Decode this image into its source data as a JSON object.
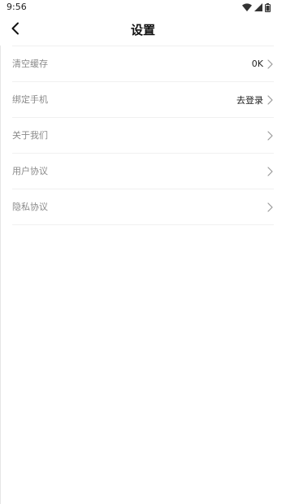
{
  "status_bar": {
    "time": "9:56",
    "icons": [
      "wifi-icon",
      "signal-icon",
      "battery-icon"
    ]
  },
  "header": {
    "title": "设置",
    "back_icon": "chevron-left-icon"
  },
  "settings": {
    "items": [
      {
        "label": "清空缓存",
        "value": "0K"
      },
      {
        "label": "绑定手机",
        "value": "去登录"
      },
      {
        "label": "关于我们",
        "value": ""
      },
      {
        "label": "用户协议",
        "value": ""
      },
      {
        "label": "隐私协议",
        "value": ""
      }
    ],
    "chevron_icon": "chevron-right-icon"
  },
  "colors": {
    "background": "#ffffff",
    "label": "#8a8a8a",
    "value": "#222222",
    "divider": "#f0f0f0",
    "chevron": "#9a9a9a"
  }
}
